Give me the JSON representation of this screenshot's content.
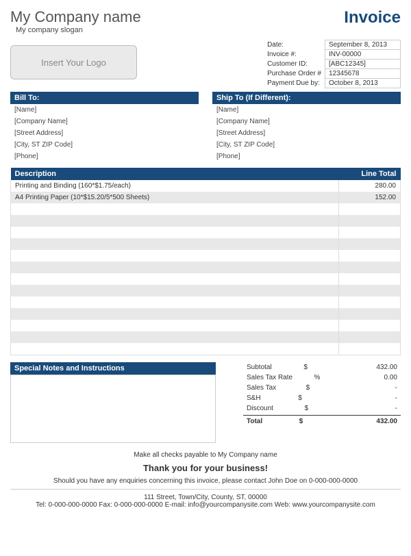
{
  "header": {
    "company_name": "My Company name",
    "slogan": "My company slogan",
    "invoice_title": "Invoice",
    "logo_placeholder": "Insert Your Logo"
  },
  "meta": {
    "date_label": "Date:",
    "date_value": "September 8, 2013",
    "invoice_num_label": "Invoice #:",
    "invoice_num_value": "INV-00000",
    "customer_id_label": "Customer ID:",
    "customer_id_value": "[ABC12345]",
    "po_label": "Purchase Order #",
    "po_value": "12345678",
    "due_label": "Payment Due by:",
    "due_value": "October 8, 2013"
  },
  "bill_to": {
    "title": "Bill To:",
    "lines": [
      "[Name]",
      "[Company Name]",
      "[Street Address]",
      "[City, ST  ZIP Code]",
      "[Phone]"
    ]
  },
  "ship_to": {
    "title": "Ship To (If Different):",
    "lines": [
      "[Name]",
      "[Company Name]",
      "[Street Address]",
      "[City, ST  ZIP Code]",
      "[Phone]"
    ]
  },
  "items": {
    "desc_header": "Description",
    "total_header": "Line Total",
    "rows": [
      {
        "desc": "Printing and Binding (160*$1.75/each)",
        "total": "280.00"
      },
      {
        "desc": "A4 Printing Paper (10*$15.20/5*500 Sheets)",
        "total": "152.00"
      },
      {
        "desc": "",
        "total": ""
      },
      {
        "desc": "",
        "total": ""
      },
      {
        "desc": "",
        "total": ""
      },
      {
        "desc": "",
        "total": ""
      },
      {
        "desc": "",
        "total": ""
      },
      {
        "desc": "",
        "total": ""
      },
      {
        "desc": "",
        "total": ""
      },
      {
        "desc": "",
        "total": ""
      },
      {
        "desc": "",
        "total": ""
      },
      {
        "desc": "",
        "total": ""
      },
      {
        "desc": "",
        "total": ""
      },
      {
        "desc": "",
        "total": ""
      },
      {
        "desc": "",
        "total": ""
      }
    ]
  },
  "notes": {
    "title": "Special Notes and Instructions"
  },
  "totals": {
    "subtotal_label": "Subtotal",
    "subtotal_sym": "$",
    "subtotal_val": "432.00",
    "taxrate_label": "Sales Tax Rate",
    "taxrate_sym": "%",
    "taxrate_val": "0.00",
    "tax_label": "Sales Tax",
    "tax_sym": "$",
    "tax_val": "-",
    "sh_label": "S&H",
    "sh_sym": "$",
    "sh_val": "-",
    "discount_label": "Discount",
    "discount_sym": "$",
    "discount_val": "-",
    "total_label": "Total",
    "total_sym": "$",
    "total_val": "432.00"
  },
  "footer": {
    "payable": "Make all checks payable to My Company name",
    "thanks": "Thank you for your business!",
    "enquiry": "Should you have any enquiries concerning this invoice, please contact John Doe on 0-000-000-0000",
    "address": "111 Street, Town/City, County, ST, 00000",
    "contact": "Tel: 0-000-000-0000 Fax: 0-000-000-0000 E-mail: info@yourcompanysite.com Web: www.yourcompanysite.com"
  }
}
